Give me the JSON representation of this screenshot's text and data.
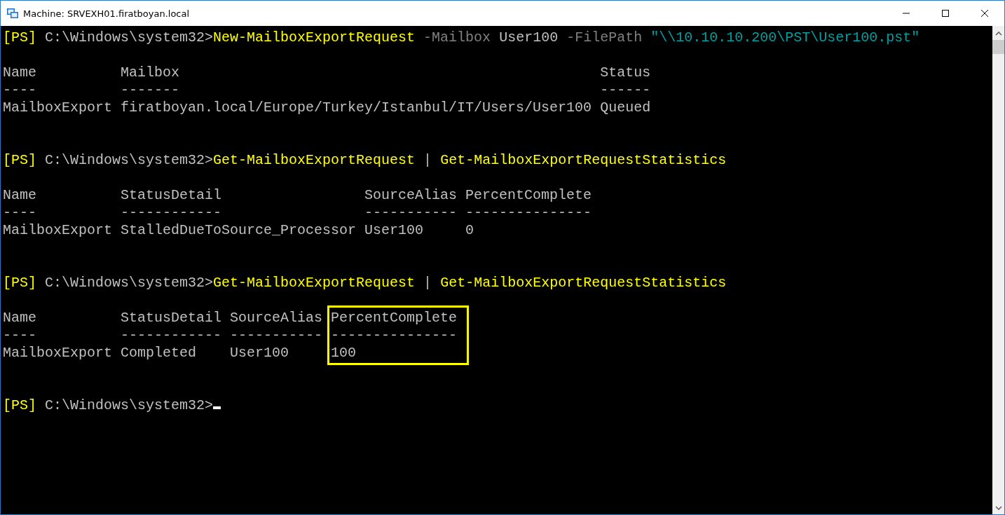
{
  "window": {
    "title": "Machine: SRVEXH01.firatboyan.local"
  },
  "console": [
    {
      "kind": "command",
      "prompt": "[PS]",
      "path": "C:\\Windows\\system32>",
      "tokens": [
        {
          "kind": "cmdlet",
          "text": "New-MailboxExportRequest"
        },
        {
          "kind": "param",
          "text": "-Mailbox"
        },
        {
          "kind": "value",
          "text": "User100"
        },
        {
          "kind": "param",
          "text": "-FilePath"
        },
        {
          "kind": "string",
          "text": "\"\\\\10.10.10.200\\PST\\User100.pst\""
        }
      ]
    },
    {
      "kind": "table",
      "columns": [
        {
          "header": "Name",
          "rule": "----",
          "highlighted": false,
          "values": [
            "MailboxExport"
          ]
        },
        {
          "header": "Mailbox",
          "rule": "-------",
          "highlighted": false,
          "values": [
            "firatboyan.local/Europe/Turkey/Istanbul/IT/Users/User100"
          ]
        },
        {
          "header": "Status",
          "rule": "------",
          "highlighted": false,
          "values": [
            "Queued"
          ]
        }
      ]
    },
    {
      "kind": "command",
      "prompt": "[PS]",
      "path": "C:\\Windows\\system32>",
      "tokens": [
        {
          "kind": "cmdlet",
          "text": "Get-MailboxExportRequest"
        },
        {
          "kind": "pipe",
          "text": "|"
        },
        {
          "kind": "cmdlet",
          "text": "Get-MailboxExportRequestStatistics"
        }
      ]
    },
    {
      "kind": "table",
      "columns": [
        {
          "header": "Name",
          "rule": "----",
          "highlighted": false,
          "values": [
            "MailboxExport"
          ]
        },
        {
          "header": "StatusDetail",
          "rule": "------------",
          "highlighted": false,
          "values": [
            "StalledDueToSource_Processor"
          ]
        },
        {
          "header": "SourceAlias",
          "rule": "-----------",
          "highlighted": false,
          "values": [
            "User100"
          ]
        },
        {
          "header": "PercentComplete",
          "rule": "---------------",
          "highlighted": false,
          "values": [
            "0"
          ]
        }
      ]
    },
    {
      "kind": "command",
      "prompt": "[PS]",
      "path": "C:\\Windows\\system32>",
      "tokens": [
        {
          "kind": "cmdlet",
          "text": "Get-MailboxExportRequest"
        },
        {
          "kind": "pipe",
          "text": "|"
        },
        {
          "kind": "cmdlet",
          "text": "Get-MailboxExportRequestStatistics"
        }
      ]
    },
    {
      "kind": "table",
      "columns": [
        {
          "header": "Name",
          "rule": "----",
          "highlighted": false,
          "values": [
            "MailboxExport"
          ]
        },
        {
          "header": "StatusDetail",
          "rule": "------------",
          "highlighted": false,
          "values": [
            "Completed"
          ]
        },
        {
          "header": "SourceAlias",
          "rule": "-----------",
          "highlighted": false,
          "values": [
            "User100"
          ]
        },
        {
          "header": "PercentComplete",
          "rule": "---------------",
          "highlighted": true,
          "values": [
            "100"
          ]
        }
      ]
    },
    {
      "kind": "prompt",
      "prompt": "[PS]",
      "path": "C:\\Windows\\system32>",
      "cursor": true
    }
  ]
}
